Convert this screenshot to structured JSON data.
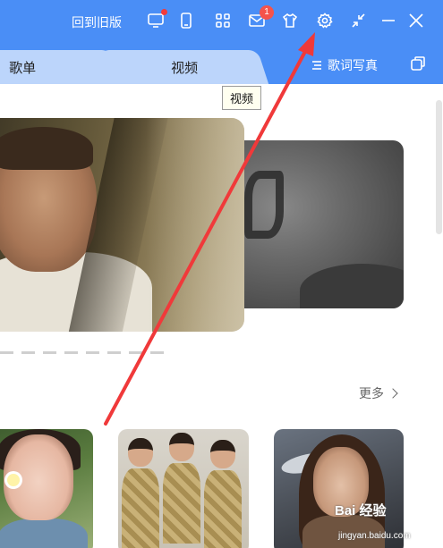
{
  "titlebar": {
    "old_version_label": "回到旧版",
    "icons": [
      "monitor-icon",
      "phone-icon",
      "apps-grid-icon",
      "mail-icon",
      "tshirt-skin-icon",
      "gear-icon",
      "shrink-icon",
      "minimize-icon",
      "close-icon"
    ],
    "mail_badge": "1",
    "accent_color": "#4a8ef6"
  },
  "tabs": {
    "items": [
      {
        "label": "歌单"
      },
      {
        "label": "视频"
      }
    ],
    "lyrics_label": "歌词写真"
  },
  "tooltip": {
    "text": "视频"
  },
  "section": {
    "more_label": "更多"
  },
  "watermark": {
    "brand": "Bai 经验",
    "domain": "jingyan.baidu.com"
  },
  "annotation": {
    "arrow_color": "#f0393a"
  }
}
